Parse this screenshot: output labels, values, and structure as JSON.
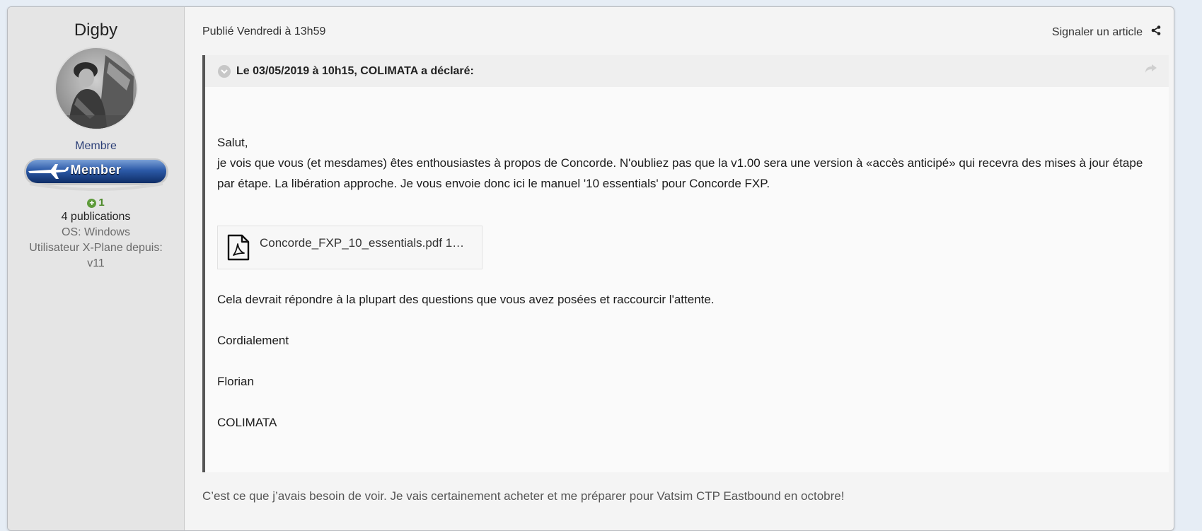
{
  "author": {
    "name": "Digby",
    "group": "Membre",
    "badge_label": "Member",
    "reputation": "1",
    "posts": "4 publications",
    "os": "OS: Windows",
    "xplane_since_label": "Utilisateur X-Plane depuis:",
    "xplane_since_value": "v11"
  },
  "post": {
    "posted_on": "Publié Vendredi à 13h59",
    "report_label": "Signaler un article",
    "quote": {
      "citation": "Le 03/05/2019 à 10h15, COLIMATA a déclaré:",
      "greeting": "Salut,",
      "body": "je vois que vous (et mesdames) êtes enthousiastes à propos de Concorde. N'oubliez pas que la v1.00 sera une version à «accès anticipé» qui recevra des mises à jour étape par étape. La libération approche. Je vous envoie donc ici le manuel '10 essentials' pour Concorde FXP.",
      "attachment_name": "Concorde_FXP_10_essentials.pdf 1…",
      "followup": "Cela devrait répondre à la plupart des questions que vous avez posées et raccourcir l'attente.",
      "closing": "Cordialement",
      "signature_1": "Florian",
      "signature_2": "COLIMATA"
    },
    "reply": "C’est ce que j’avais besoin de voir. Je vais certainement acheter et me préparer pour Vatsim CTP Eastbound en octobre!"
  },
  "colors": {
    "group": "#2c3f77",
    "reputation": "#4d8a2a",
    "quote_border": "#555555"
  }
}
